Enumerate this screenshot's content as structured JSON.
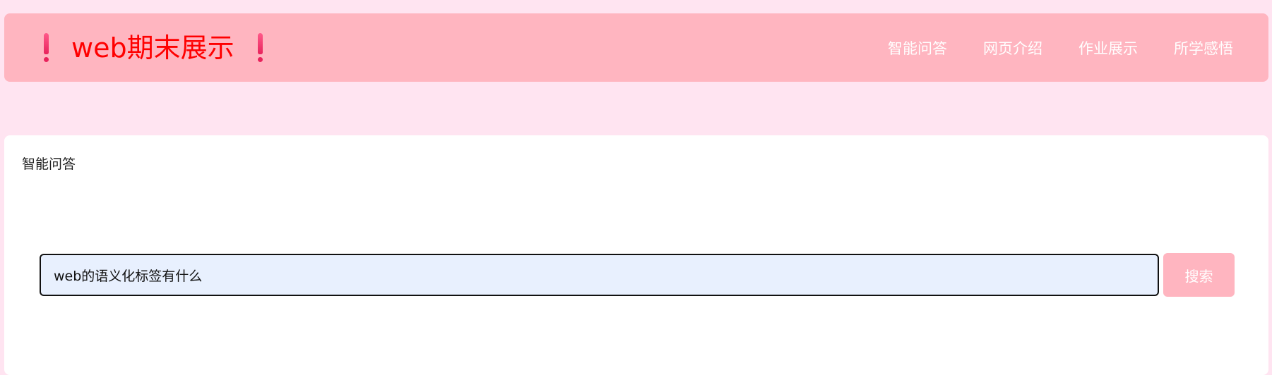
{
  "header": {
    "title": "web期末展示",
    "left_icon": "exclamation-icon",
    "right_icon": "exclamation-icon",
    "nav_items": [
      {
        "label": "智能问答"
      },
      {
        "label": "网页介绍"
      },
      {
        "label": "作业展示"
      },
      {
        "label": "所学感悟"
      }
    ]
  },
  "qa": {
    "title": "智能问答",
    "search_value": "web的语义化标签有什么",
    "search_button_label": "搜索"
  },
  "colors": {
    "page_background": "#ffe4f1",
    "header_background": "#ffb5c0",
    "title_color": "#ff0000",
    "input_background": "#e8f0fe",
    "button_background": "#ffb5c0"
  }
}
